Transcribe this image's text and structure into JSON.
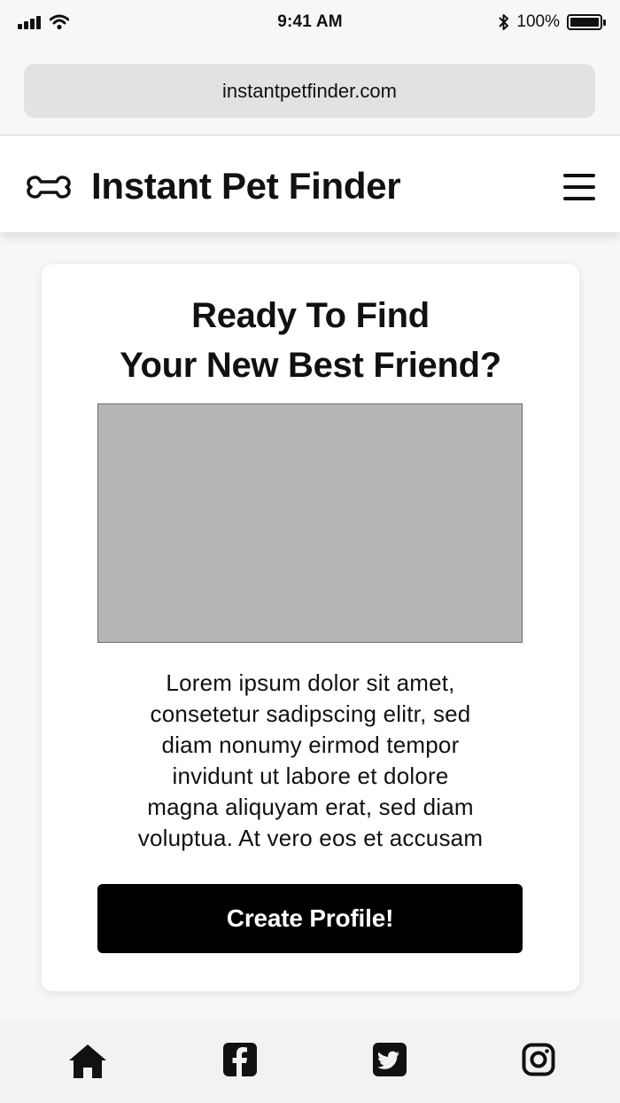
{
  "status_bar": {
    "time": "9:41 AM",
    "battery_percent": "100%",
    "icons": [
      "signal-icon",
      "wifi-icon",
      "bluetooth-icon",
      "battery-icon"
    ]
  },
  "browser": {
    "url": "instantpetfinder.com"
  },
  "header": {
    "title": "Instant Pet Finder",
    "logo_icon": "bone-icon",
    "menu_icon": "hamburger-menu-icon"
  },
  "hero_card": {
    "heading_line1": "Ready To Find",
    "heading_line2": "Your New Best Friend?",
    "image": "placeholder",
    "body_lines": [
      "Lorem ipsum dolor sit amet,",
      "consetetur sadipscing elitr, sed",
      "diam nonumy eirmod tempor",
      "invidunt ut labore et dolore",
      "magna aliquyam erat, sed diam",
      "voluptua. At vero eos et accusam"
    ],
    "button_label": "Create Profile!"
  },
  "bottom_nav": {
    "items": [
      "home-icon",
      "facebook-icon",
      "twitter-icon",
      "instagram-icon"
    ]
  },
  "colors": {
    "accent": "#000000",
    "placeholder": "#b5b5b5",
    "background": "#f7f7f7"
  }
}
